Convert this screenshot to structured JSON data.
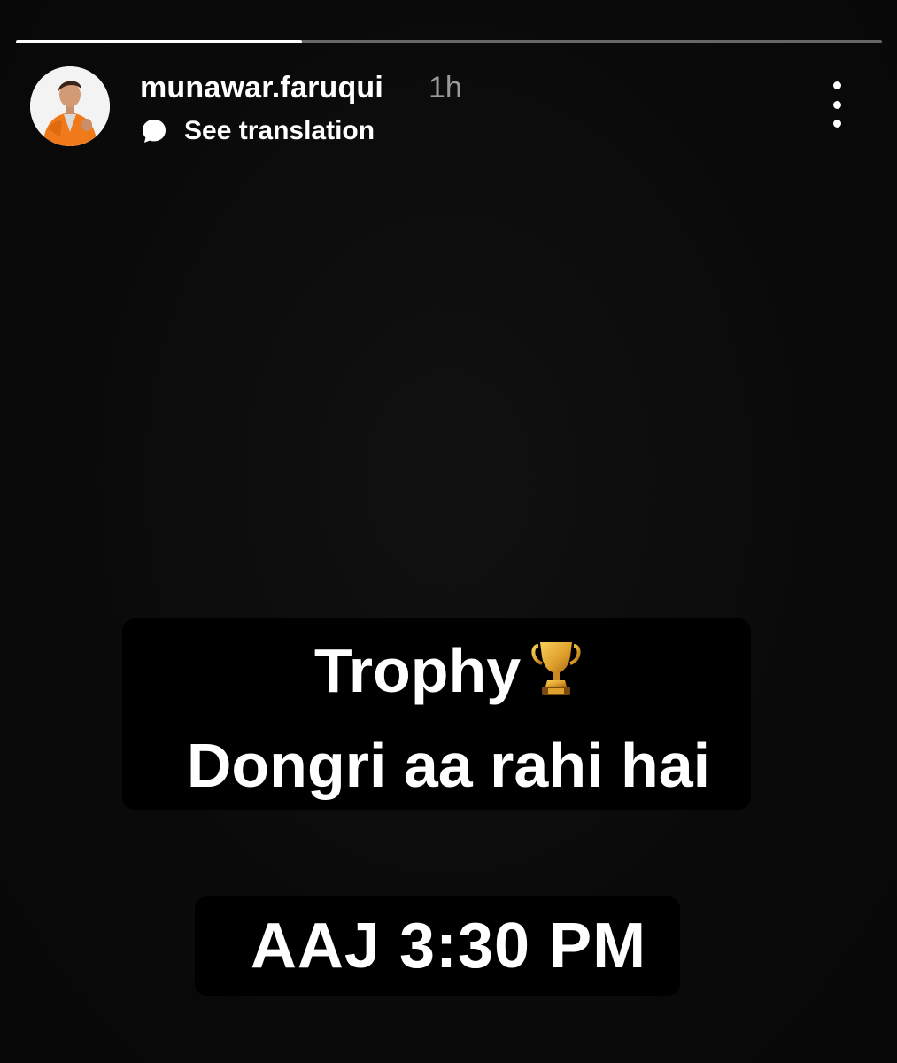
{
  "story": {
    "progress": 0.33,
    "username": "munawar.faruqui",
    "time_ago": "1h",
    "translate_label": "See translation",
    "avatar_icon": "profile-photo-orange-jacket",
    "more_icon": "vertical-dots-icon"
  },
  "content": {
    "line1": "Trophy",
    "line1_emoji": "trophy-icon",
    "line2": "Dongri aa rahi hai",
    "line3": "AAJ 3:30 PM"
  },
  "colors": {
    "background": "#0b0b0b",
    "text": "#ffffff",
    "muted": "#9a9a9a",
    "trophy_gold": "#e0a12c",
    "avatar_jacket": "#f07a1a"
  }
}
